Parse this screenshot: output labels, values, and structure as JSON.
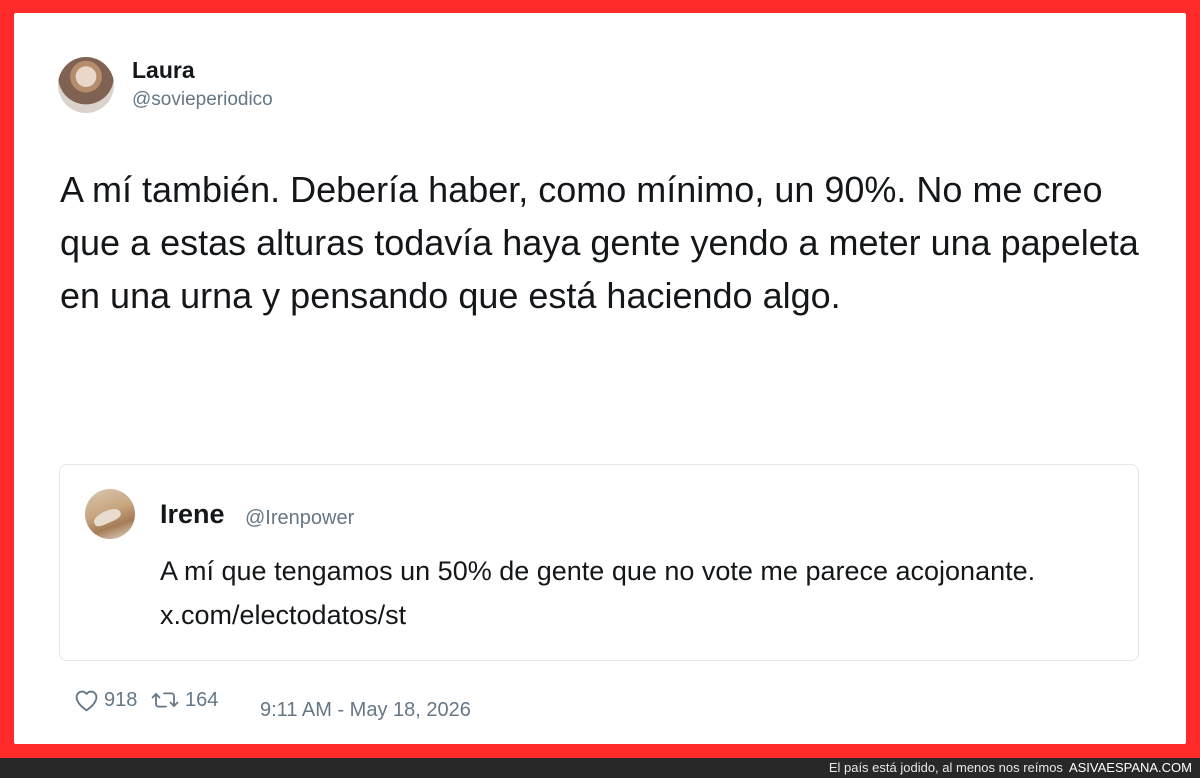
{
  "tweet": {
    "author_name": "Laura",
    "author_handle": "@sovieperiodico",
    "text": "A mí también. Debería haber, como mínimo, un 90%. No me creo que a estas alturas todavía haya gente yendo a meter una papeleta en una urna y pensando que está haciendo algo.",
    "quoted_tweet": {
      "author_name": "Irene",
      "author_handle": "@Irenpower",
      "text": "A mí que tengamos un 50% de gente que no vote me parece acojonante. x.com/electodatos/st"
    },
    "stats": {
      "likes": "918",
      "retweets": "164"
    },
    "timestamp": "9:11 AM - May 18, 2026",
    "icons": {
      "like": "heart-icon",
      "retweet": "retweet-icon"
    }
  },
  "footer": {
    "caption": "El país está jodido, al menos nos reímos",
    "brand": "ASIVAESPANA.COM"
  },
  "colors": {
    "frame": "#ff2a2a",
    "card": "#ffffff",
    "text": "#14171a",
    "muted": "#657786",
    "border": "#e1e8ed",
    "footer": "#282828"
  }
}
